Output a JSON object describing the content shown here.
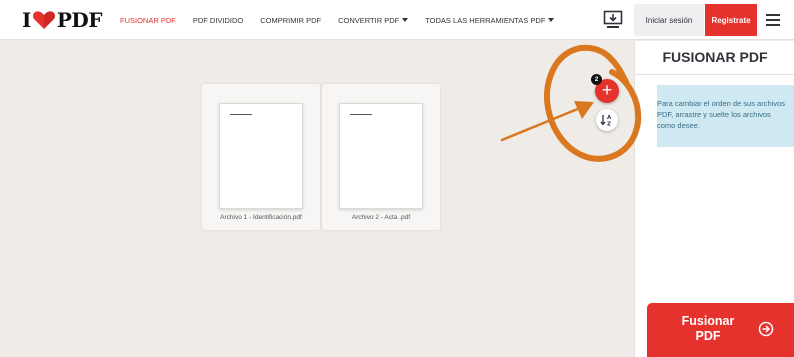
{
  "header": {
    "logo_text_left": "I",
    "logo_text_right": "PDF",
    "nav": [
      {
        "label": "FUSIONAR PDF",
        "active": true
      },
      {
        "label": "PDF DIVIDIDO",
        "active": false
      },
      {
        "label": "COMPRIMIR PDF",
        "active": false
      },
      {
        "label": "CONVERTIR PDF",
        "active": false
      },
      {
        "label": "TODAS LAS HERRAMIENTAS PDF",
        "active": false
      }
    ],
    "login_label": "Iniciar sesión",
    "signup_label": "Registrate"
  },
  "workspace": {
    "files": [
      {
        "name": "Archivo 1 - Identificación.pdf"
      },
      {
        "name": "Archivo 2 - Acta .pdf"
      }
    ],
    "file_count": "2",
    "add_icon": "plus-icon",
    "sort_icon": "sort-az-icon"
  },
  "sidebar": {
    "title": "FUSIONAR PDF",
    "info_text": "Para cambiar el orden de sus archivos PDF, arrastre y suelte los archivos como desee.",
    "merge_label_line1": "Fusionar",
    "merge_label_line2": "PDF"
  },
  "colors": {
    "brand_red": "#e5322d",
    "info_bg": "#cfe9f3",
    "annotation_orange": "#d9781e"
  }
}
